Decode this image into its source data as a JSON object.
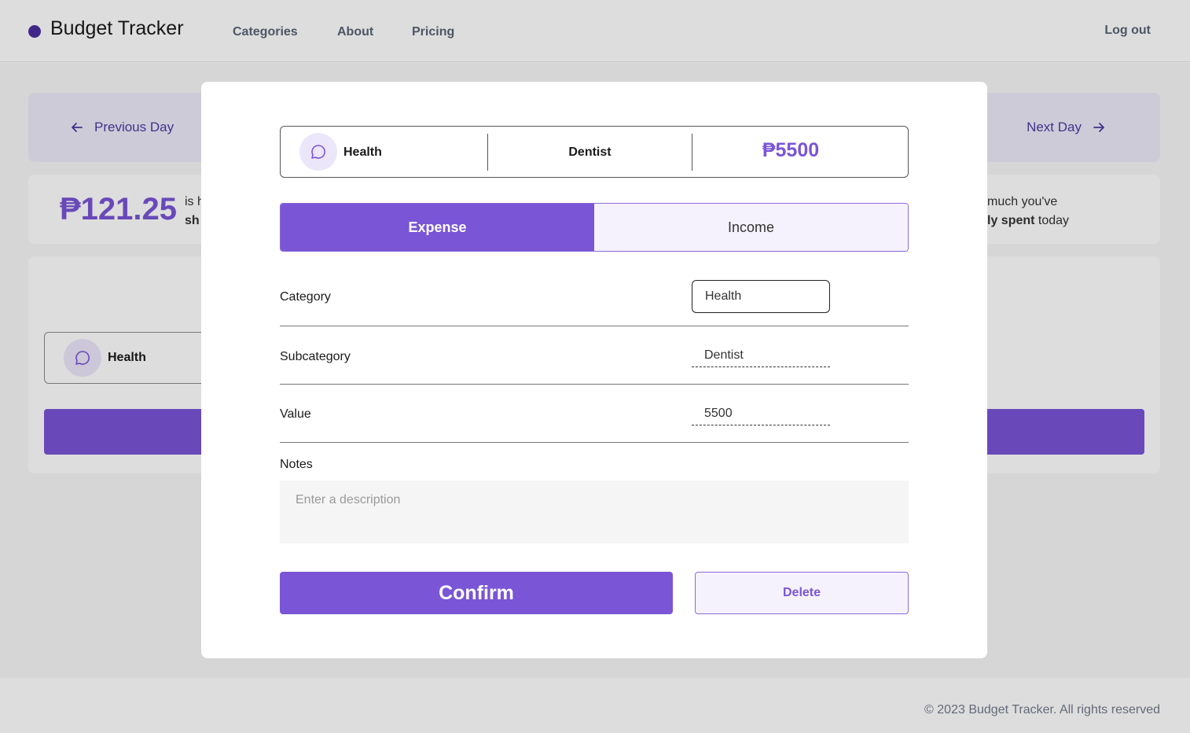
{
  "app": {
    "brand": "Budget Tracker"
  },
  "nav": {
    "links": [
      "Categories",
      "About",
      "Pricing"
    ],
    "logout": "Log out"
  },
  "day_nav": {
    "prev": "Previous Day",
    "next": "Next Day"
  },
  "summary": {
    "amount": "₱121.25",
    "left_line1": "is h",
    "left_line2": "sh",
    "right_line1": "much you've",
    "right_bold": "ly spent",
    "right_rest": " today"
  },
  "list": {
    "item_category": "Health"
  },
  "modal": {
    "header": {
      "category": "Health",
      "subcategory": "Dentist",
      "value": "₱5500"
    },
    "toggle": {
      "expense": "Expense",
      "income": "Income",
      "selected": "Expense"
    },
    "fields": {
      "category_label": "Category",
      "category_value": "Health",
      "subcategory_label": "Subcategory",
      "subcategory_value": "Dentist",
      "value_label": "Value",
      "value_value": "5500",
      "notes_label": "Notes",
      "notes_placeholder": "Enter a description"
    },
    "buttons": {
      "confirm": "Confirm",
      "delete": "Delete"
    }
  },
  "footer": {
    "text": "© 2023 Budget Tracker. All rights reserved"
  },
  "colors": {
    "accent": "#7a55d6",
    "brand_dot": "#4b2c9f",
    "accent_light": "#f6f2fd"
  }
}
